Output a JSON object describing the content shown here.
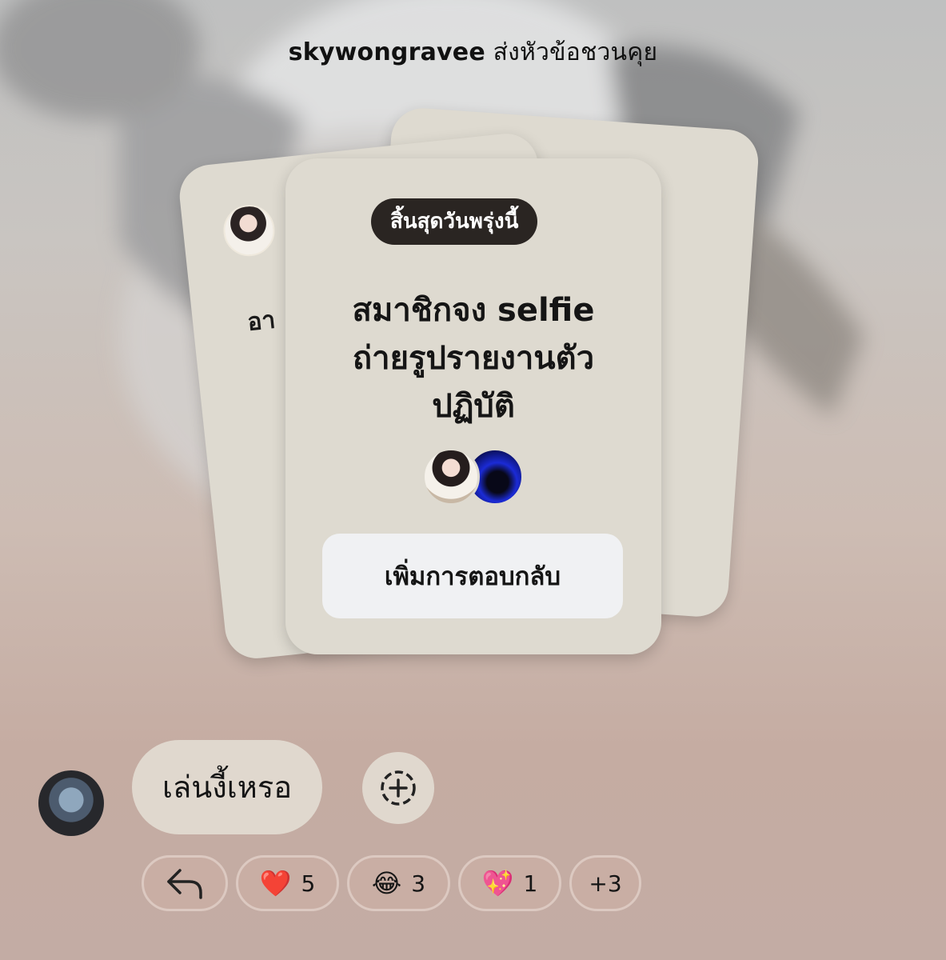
{
  "header": {
    "username": "skywongravee",
    "action_text": "ส่งหัวข้อชวนคุย"
  },
  "back_card": {
    "text_fragment": "อา"
  },
  "card": {
    "badge": "สิ้นสุดวันพรุ่งนี้",
    "prompt_lines": [
      "สมาชิกจง selfie",
      "ถ่ายรูปรายงานตัว",
      "ปฏิบัติ"
    ],
    "reply_button_label": "เพิ่มการตอบกลับ"
  },
  "message": {
    "text": "เล่นงี้เหรอ"
  },
  "reactions": [
    {
      "icon": "reply-arrow-icon",
      "count": ""
    },
    {
      "icon": "red-heart-emoji",
      "glyph": "❤️",
      "count": "5"
    },
    {
      "icon": "tears-of-joy-emoji",
      "glyph": "😂",
      "count": "3"
    },
    {
      "icon": "sparkling-heart-emoji",
      "glyph": "💖",
      "count": "1"
    },
    {
      "icon": "more",
      "count": "+3"
    }
  ],
  "colors": {
    "card_bg": "#dedad0",
    "badge_bg": "#2a2522",
    "reply_button_bg": "#f0f1f3",
    "bubble_bg": "#e0d8ce"
  }
}
